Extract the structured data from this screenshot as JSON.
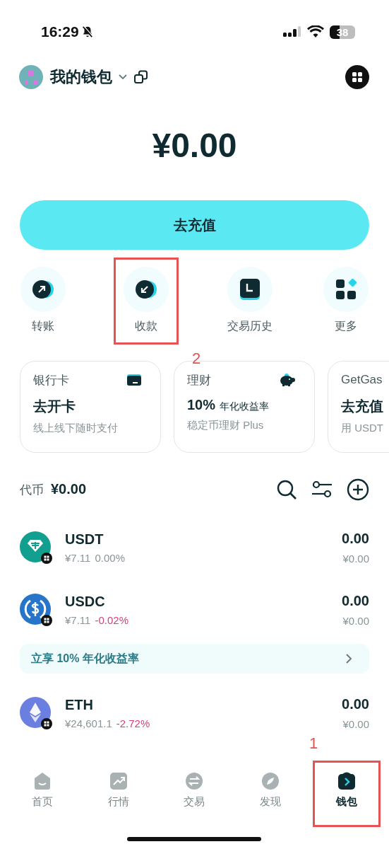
{
  "status_bar": {
    "time": "16:29",
    "battery": "38"
  },
  "header": {
    "wallet_name": "我的钱包"
  },
  "balance": "¥0.00",
  "deposit_button": "去充值",
  "actions": [
    {
      "kind": "send",
      "label": "转账"
    },
    {
      "kind": "receive",
      "label": "收款",
      "annotation": "2"
    },
    {
      "kind": "history",
      "label": "交易历史"
    },
    {
      "kind": "more",
      "label": "更多"
    }
  ],
  "cards": [
    {
      "kind": "card",
      "title": "银行卡",
      "headline": "去开卡",
      "subtitle": "线上线下随时支付"
    },
    {
      "kind": "piggy",
      "title": "理财",
      "headline": "10%",
      "headline_note": "年化收益率",
      "subtitle": "稳定币理财 Plus"
    },
    {
      "kind": "none",
      "title": "GetGas",
      "headline": "去充值",
      "subtitle": "用 USDT"
    }
  ],
  "tokens_header": {
    "label": "代币",
    "total": "¥0.00"
  },
  "tokens": [
    {
      "kind": "usdt",
      "symbol": "USDT",
      "price": "¥7.11",
      "change": "0.00%",
      "color": "#8a9598",
      "amount": "0.00",
      "value": "¥0.00"
    },
    {
      "kind": "usdc",
      "symbol": "USDC",
      "price": "¥7.11",
      "change": "-0.02%",
      "color": "#d63f7b",
      "amount": "0.00",
      "value": "¥0.00"
    },
    {
      "kind": "promo",
      "text": "立享 10% 年化收益率"
    },
    {
      "kind": "eth",
      "symbol": "ETH",
      "price": "¥24,601.1",
      "change": "-2.72%",
      "color": "#d63f7b",
      "amount": "0.00",
      "value": "¥0.00"
    }
  ],
  "tab_bar": [
    {
      "kind": "home",
      "label": "首页",
      "selected": false
    },
    {
      "kind": "market",
      "label": "行情",
      "selected": false
    },
    {
      "kind": "trade",
      "label": "交易",
      "selected": false
    },
    {
      "kind": "discover",
      "label": "发现",
      "selected": false
    },
    {
      "kind": "wallet",
      "label": "钱包",
      "selected": true,
      "annotation": "1"
    }
  ]
}
